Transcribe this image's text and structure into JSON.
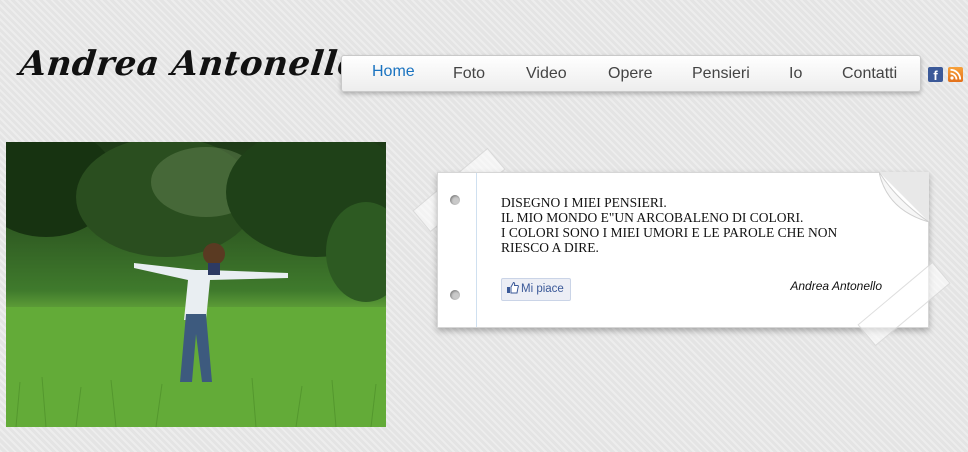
{
  "site": {
    "title": "Andrea Antonello"
  },
  "nav": {
    "items": [
      {
        "label": "Home",
        "active": true
      },
      {
        "label": "Foto"
      },
      {
        "label": "Video"
      },
      {
        "label": "Opere"
      },
      {
        "label": "Pensieri"
      },
      {
        "label": "Io"
      },
      {
        "label": "Contatti"
      }
    ]
  },
  "social": {
    "facebook_icon": "facebook-icon",
    "facebook_glyph": "f",
    "rss_icon": "rss-icon"
  },
  "photo": {
    "subject": "man-in-grass-field-photo"
  },
  "quote": {
    "lines": [
      "DISEGNO I MIEI PENSIERI.",
      "IL MIO MONDO E\"UN ARCOBALENO DI COLORI.",
      "I COLORI SONO I MIEI UMORI E LE PAROLE CHE NON",
      "RIESCO A DIRE."
    ],
    "author": "Andrea Antonello"
  },
  "like": {
    "label": "Mi piace"
  },
  "colors": {
    "accent": "#1a73c0",
    "facebook": "#3b5998",
    "rss": "#f29423"
  }
}
